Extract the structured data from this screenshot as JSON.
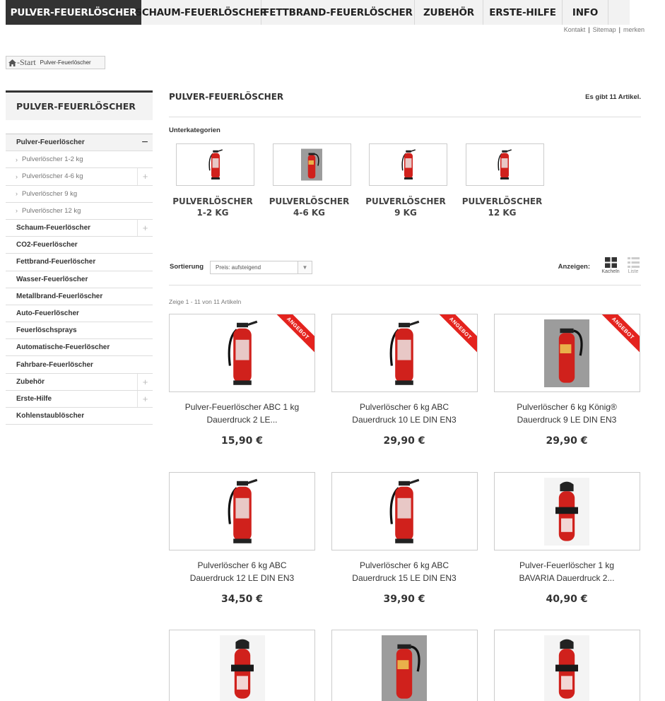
{
  "nav": {
    "items": [
      {
        "label": "PULVER-FEUERLÖSCHER",
        "active": true
      },
      {
        "label": "SCHAUM-FEUERLÖSCHER",
        "active": false
      },
      {
        "label": "FETTBRAND-FEUERLÖSCHER",
        "active": false
      },
      {
        "label": "ZUBEHÖR",
        "active": false
      },
      {
        "label": "ERSTE-HILFE",
        "active": false
      },
      {
        "label": "INFO",
        "active": false
      }
    ]
  },
  "toplinks": {
    "contact": "Kontakt",
    "sitemap": "Sitemap",
    "bookmark": "merken",
    "separator": "|"
  },
  "breadcrumb": {
    "home": "-Start",
    "current": "Pulver-Feuerlöscher"
  },
  "sidebar": {
    "title": "PULVER-FEUERLÖSCHER",
    "items": [
      {
        "label": "Pulver-Feuerlöscher",
        "level": 1,
        "open": true,
        "toggle": "−"
      },
      {
        "label": "Pulverlöscher 1-2 kg",
        "level": 2,
        "toggle": ""
      },
      {
        "label": "Pulverlöscher 4-6 kg",
        "level": 2,
        "toggle": "+"
      },
      {
        "label": "Pulverlöscher 9 kg",
        "level": 2,
        "toggle": ""
      },
      {
        "label": "Pulverlöscher 12 kg",
        "level": 2,
        "toggle": ""
      },
      {
        "label": "Schaum-Feuerlöscher",
        "level": 1,
        "toggle": "+"
      },
      {
        "label": "CO2-Feuerlöscher",
        "level": 1,
        "toggle": ""
      },
      {
        "label": "Fettbrand-Feuerlöscher",
        "level": 1,
        "toggle": ""
      },
      {
        "label": "Wasser-Feuerlöscher",
        "level": 1,
        "toggle": ""
      },
      {
        "label": "Metallbrand-Feuerlöscher",
        "level": 1,
        "toggle": ""
      },
      {
        "label": "Auto-Feuerlöscher",
        "level": 1,
        "toggle": ""
      },
      {
        "label": "Feuerlöschsprays",
        "level": 1,
        "toggle": ""
      },
      {
        "label": "Automatische-Feuerlöscher",
        "level": 1,
        "toggle": ""
      },
      {
        "label": "Fahrbare-Feuerlöscher",
        "level": 1,
        "toggle": ""
      },
      {
        "label": "Zubehör",
        "level": 1,
        "toggle": "+"
      },
      {
        "label": "Erste-Hilfe",
        "level": 1,
        "toggle": "+"
      },
      {
        "label": "Kohlenstaublöscher",
        "level": 1,
        "toggle": ""
      }
    ],
    "caret": "›"
  },
  "main": {
    "title": "PULVER-FEUERLÖSCHER",
    "count": "Es gibt 11 Artikel.",
    "subcategories_label": "Unterkategorien",
    "subcategories": [
      {
        "line1": "PULVERLÖSCHER",
        "line2": "1-2 KG"
      },
      {
        "line1": "PULVERLÖSCHER",
        "line2": "4-6 KG"
      },
      {
        "line1": "PULVERLÖSCHER",
        "line2": "9 KG"
      },
      {
        "line1": "PULVERLÖSCHER",
        "line2": "12 KG"
      }
    ],
    "sort_label": "Sortierung",
    "sort_value": "Preis: aufsteigend",
    "view_label": "Anzeigen:",
    "view_grid": "Kacheln",
    "view_list": "Liste",
    "showing": "Zeige 1 - 11 von 11 Artikeln",
    "ribbon_text": "ANGEBOT",
    "products": [
      {
        "line1": "Pulver-Feuerlöscher ABC 1 kg",
        "line2": "Dauerdruck 2 LE...",
        "price": "15,90 €",
        "sale": true
      },
      {
        "line1": "Pulverlöscher 6 kg ABC",
        "line2": "Dauerdruck 10 LE DIN EN3",
        "price": "29,90 €",
        "sale": true
      },
      {
        "line1": "Pulverlöscher 6 kg König®",
        "line2": "Dauerdruck 9 LE DIN EN3",
        "price": "29,90 €",
        "sale": true
      },
      {
        "line1": "Pulverlöscher 6 kg ABC",
        "line2": "Dauerdruck 12 LE DIN EN3",
        "price": "34,50 €",
        "sale": false
      },
      {
        "line1": "Pulverlöscher 6 kg ABC",
        "line2": "Dauerdruck 15 LE DIN EN3",
        "price": "39,90 €",
        "sale": false
      },
      {
        "line1": "Pulver-Feuerlöscher 1 kg",
        "line2": "BAVARIA Dauerdruck 2...",
        "price": "40,90 €",
        "sale": false
      }
    ]
  },
  "colors": {
    "nav_active": "#333333",
    "ribbon": "#e4231e",
    "extinguisher": "#d0211c"
  }
}
